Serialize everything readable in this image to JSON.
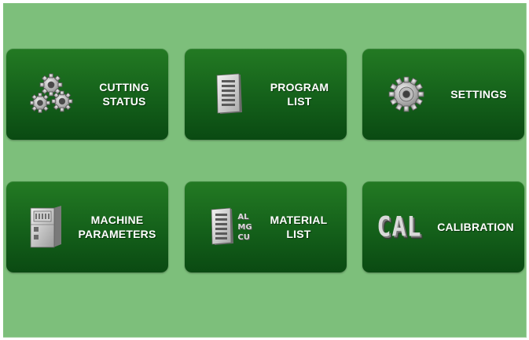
{
  "tiles": {
    "cutting_status": {
      "line1": "CUTTING",
      "line2": "STATUS",
      "icon": "gears-icon"
    },
    "program_list": {
      "line1": "PROGRAM",
      "line2": "LIST",
      "icon": "document-list-icon"
    },
    "settings": {
      "line1": "SETTINGS",
      "icon": "gear-icon"
    },
    "machine_parameters": {
      "line1": "MACHINE",
      "line2": "PARAMETERS",
      "icon": "machine-cabinet-icon"
    },
    "material_list": {
      "line1": "MATERIAL",
      "line2": "LIST",
      "icon": "material-list-icon",
      "codes": [
        "AL",
        "MG",
        "CU"
      ]
    },
    "calibration": {
      "line1": "CALIBRATION",
      "icon": "cal-icon",
      "icon_text": "CAL"
    }
  },
  "colors": {
    "background": "#7dbf7b",
    "tile_top": "#237a23",
    "tile_bottom": "#0a4a12",
    "label": "#ffffff"
  }
}
